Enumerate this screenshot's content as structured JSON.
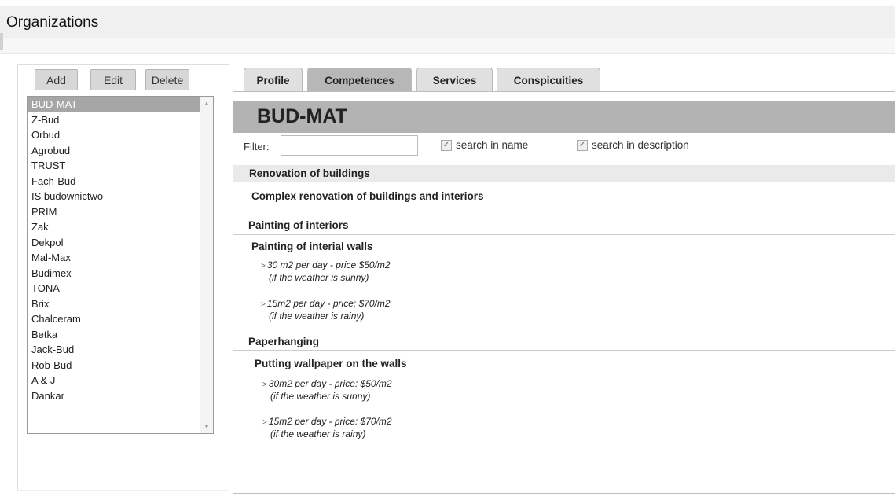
{
  "page": {
    "title": "Organizations"
  },
  "toolbar": {
    "add_label": "Add",
    "edit_label": "Edit",
    "delete_label": "Delete"
  },
  "organizations": {
    "selected_index": 0,
    "items": [
      "BUD-MAT",
      "Z-Bud",
      "Orbud",
      "Agrobud",
      "TRUST",
      "Fach-Bud",
      "IS budownictwo",
      "PRIM",
      "Żak",
      "Dekpol",
      "Mal-Max",
      "Budimex",
      "TONA",
      "Brix",
      "Chalceram",
      "Betka",
      "Jack-Bud",
      "Rob-Bud",
      "A & J",
      "Dankar"
    ]
  },
  "tabs": [
    {
      "label": "Profile",
      "active": false
    },
    {
      "label": "Competences",
      "active": true
    },
    {
      "label": "Services",
      "active": false
    },
    {
      "label": "Conspicuities",
      "active": false
    }
  ],
  "detail": {
    "org_name": "BUD-MAT",
    "filter": {
      "label": "Filter:",
      "value": "",
      "search_in_name": {
        "label": "search in name",
        "checked": true
      },
      "search_in_description": {
        "label": "search in description",
        "checked": true
      }
    },
    "categories": [
      {
        "title": "Renovation of buildings",
        "competence": "Complex renovation of buildings and interiors"
      },
      {
        "title": "Painting of interiors",
        "competence": "Painting of interial walls",
        "details": [
          {
            "line1": "30 m2 per day - price $50/m2",
            "line2": "(if the weather is sunny)"
          },
          {
            "line1": "15m2 per day - price: $70/m2",
            "line2": "(if the weather is rainy)"
          }
        ]
      },
      {
        "title": "Paperhanging",
        "competence": "Putting wallpaper on the walls",
        "details": [
          {
            "line1": "30m2 per day - price: $50/m2",
            "line2": "(if the weather is sunny)"
          },
          {
            "line1": "15m2 per day - price: $70/m2",
            "line2": "(if the weather is rainy)"
          }
        ]
      }
    ]
  }
}
